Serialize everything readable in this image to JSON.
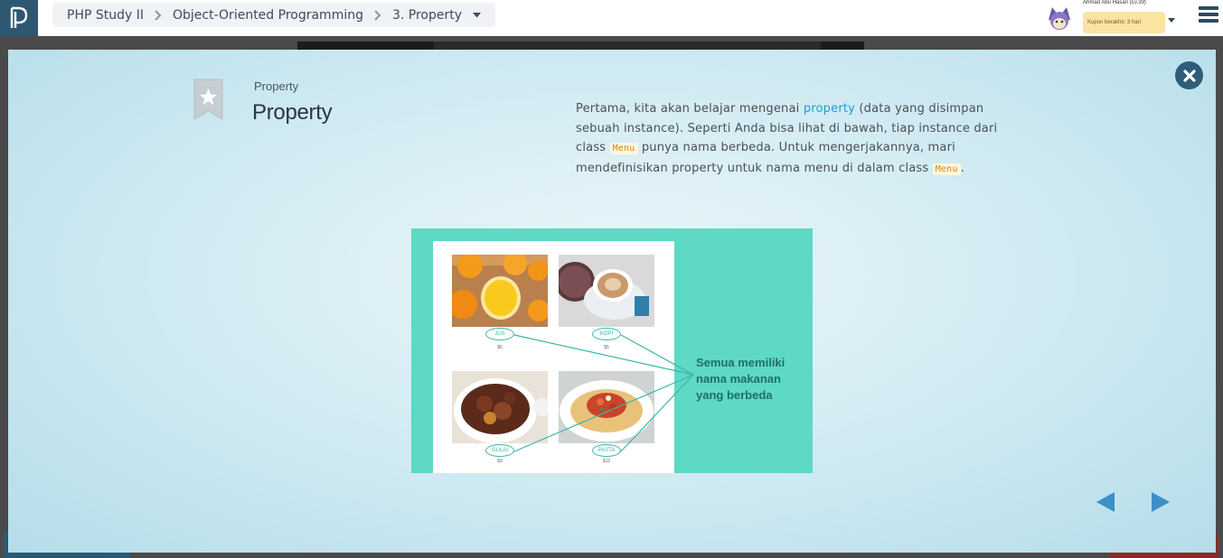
{
  "topbar": {
    "breadcrumb": [
      "PHP Study II",
      "Object-Oriented Programming",
      "3. Property"
    ],
    "user_name": "Ahmad Abu Hasan (Lv.39)",
    "coupon": "Kupon berakhir: 3 hari"
  },
  "modal": {
    "subtitle": "Property",
    "title": "Property",
    "desc": {
      "p1": "Pertama, kita akan belajar mengenai ",
      "hl": "property",
      "p2": " (data yang disimpan sebuah instance). Seperti Anda bisa lihat di bawah, tiap instance dari class ",
      "code1": "Menu",
      "p3": " punya nama berbeda. Untuk mengerjakannya, mari mendefinisikan property untuk nama menu di dalam class ",
      "code2": "Menu",
      "p4": "."
    },
    "illustration": {
      "items": [
        {
          "name": "JUS",
          "price": "$6"
        },
        {
          "name": "KOPI",
          "price": "$5"
        },
        {
          "name": "GULAI",
          "price": "$9"
        },
        {
          "name": "PASTA",
          "price": "$12"
        }
      ],
      "caption": [
        "Semua memiliki",
        "nama makanan",
        "yang berbeda"
      ]
    }
  },
  "colors": {
    "accent": "#1b9fd0",
    "illustration_bg": "#5dd9c5",
    "close_button": "#2f5c79",
    "nav_arrow": "#3d8fc8"
  },
  "icons": {
    "logo": "progate-logo-icon",
    "close": "close-icon",
    "bookmark": "bookmark-star-icon",
    "prev": "prev-arrow-icon",
    "next": "next-arrow-icon"
  }
}
